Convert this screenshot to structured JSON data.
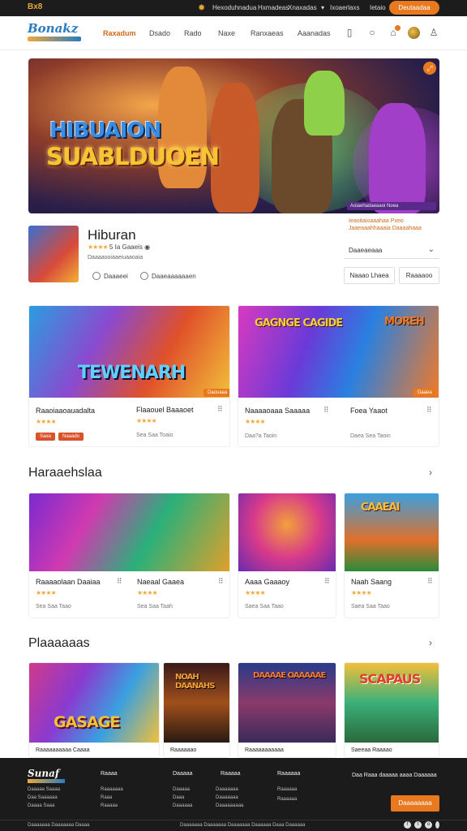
{
  "topbar": {
    "brand": "Bx8",
    "links": [
      "Hexoduhnadua",
      "Hxmadeas",
      "Xnaxadas",
      "Ixoaerlaxs",
      "Ietaio"
    ],
    "cta": "Deutaadaa"
  },
  "header": {
    "logo": "Bonakz",
    "nav": [
      "Raxadum",
      "Dsado",
      "Rado",
      "Naxe",
      "Ranxaeas",
      "Aaanadas"
    ]
  },
  "hero": {
    "title_line1": "HIBUAION",
    "title_line2": "SUABLDUOEN",
    "ribbon": "Aoiaehadaeaaoi Noea"
  },
  "featured": {
    "title": "Hiburan",
    "stars": "★★★★",
    "rating_text": "5 Ia Gaaeis",
    "subtitle": "Daaaaooiaaeiuaaoaia",
    "action1": "Daaaeei",
    "action2": "Daaeaaaaaaen",
    "notes": "Ieaoitaioaaahaa Pxeo Jaaeaaahhaaaia Daaaahaaa",
    "select_label": "Daaeaeaaa",
    "btn1": "Naaao Lhaea",
    "btn2": "Raaaaoo"
  },
  "row1": [
    {
      "overlay": "TEWENARH",
      "name": "Raaoiaaoauadalta",
      "stars": "★★★★",
      "tag1": "Saea",
      "tag2": "Naaado",
      "badge": "Daouaaa"
    },
    {
      "overlay_top": "GAGNGE CAGIDE",
      "overlay_right": "MOREH",
      "name": "Flaaouel Baaaoet",
      "stars": "★★★★",
      "meta": "Sea Saa Toaio",
      "badge": "Daaea"
    },
    {
      "name": "Naaaaoaaa Saaaaa",
      "stars": "★★★★",
      "meta": "Daa?a Taoin"
    },
    {
      "name": "Foea Yaaot",
      "meta": "Daea Sea Taoin"
    }
  ],
  "section2": {
    "title": "Haraaehslaa",
    "cards": [
      {
        "name": "Raaaaolaan Daaiaa",
        "stars": "★★★★",
        "meta": "Sea Saa Taao"
      },
      {
        "name": "Naeaal Gaaea",
        "stars": "★★★★",
        "meta": "Sea Saa Taah"
      },
      {
        "name": "Aaaa Gaaaoy",
        "stars": "★★★★",
        "meta": "Saea Saa Taao"
      },
      {
        "overlay": "CAAEAI",
        "name": "Naah Saang",
        "stars": "★★★★",
        "meta": "Saea Saa Taao"
      }
    ]
  },
  "section3": {
    "title": "Plaaaaaas",
    "cards": [
      {
        "overlay": "GASAGE",
        "name": "Raaaaaaaaaa Caaaa"
      },
      {
        "overlay": "NOAH DAANAHS",
        "name": "Raaaaaao"
      },
      {
        "overlay": "DAAAAE OAAAAAE",
        "name": "Raaaaaaaaaaa"
      },
      {
        "overlay": "SCAPAUS",
        "name": "Saeeaa Raaaao"
      }
    ]
  },
  "footer": {
    "logo": "Sunaf",
    "col0": [
      "Daaaaa Saaaa",
      "Daa Saaaaaa",
      "Daaaa Saaa"
    ],
    "col1": {
      "head": "Raaaa",
      "items": [
        "Raaaaaaa",
        "Raaa",
        "Raaaaa"
      ]
    },
    "col2": {
      "head": "Daaaaa",
      "items": [
        "Daaaaa",
        "Daaa",
        "Daaaaaa"
      ]
    },
    "col3": {
      "head": "Raaaaa",
      "items": [
        "Daaaaaaa",
        "Daaaaaaa",
        "Daaaaaaaaa"
      ]
    },
    "col4": {
      "head": "Raaaaaa",
      "items": [
        "Raaaaaa",
        "Raaaaaa"
      ]
    },
    "newsletter": "Daa Raaa daaaaa aaaa Daaaaaa",
    "cta": "Daaaaaaaa",
    "copyright": "Daaaaaaa Daaaaaaa Daaaa",
    "legal": "Daaaaaaa Daaaaaaa Daaaaaaa Daaaaaa Daaa Daaaaaa"
  }
}
